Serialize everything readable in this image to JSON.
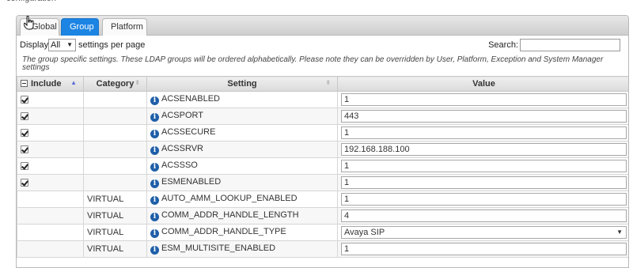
{
  "caption": "configuration",
  "tabs": [
    {
      "label": "Global",
      "active": false
    },
    {
      "label": "Group",
      "active": true
    },
    {
      "label": "Platform",
      "active": false
    }
  ],
  "controls": {
    "display_label": "Display",
    "display_value": "All",
    "per_page_label": "settings per page",
    "search_label": "Search:",
    "search_value": ""
  },
  "note": "The group specific settings. These LDAP groups will be ordered alphabetically. Please note they can be overridden by User, Platform, Exception and System Manager settings",
  "columns": {
    "include": "Include",
    "category": "Category",
    "setting": "Setting",
    "value": "Value"
  },
  "rows": [
    {
      "checked": true,
      "category": "",
      "setting": "ACSENABLED",
      "value": "1"
    },
    {
      "checked": true,
      "category": "",
      "setting": "ACSPORT",
      "value": "443"
    },
    {
      "checked": true,
      "category": "",
      "setting": "ACSSECURE",
      "value": "1"
    },
    {
      "checked": true,
      "category": "",
      "setting": "ACSSRVR",
      "value": "192.168.188.100"
    },
    {
      "checked": true,
      "category": "",
      "setting": "ACSSSO",
      "value": "1"
    },
    {
      "checked": true,
      "category": "",
      "setting": "ESMENABLED",
      "value": "1"
    },
    {
      "checked": null,
      "category": "VIRTUAL",
      "setting": "AUTO_AMM_LOOKUP_ENABLED",
      "value": "1"
    },
    {
      "checked": null,
      "category": "VIRTUAL",
      "setting": "COMM_ADDR_HANDLE_LENGTH",
      "value": "4"
    },
    {
      "checked": null,
      "category": "VIRTUAL",
      "setting": "COMM_ADDR_HANDLE_TYPE",
      "value": "Avaya SIP",
      "dropdown": true
    },
    {
      "checked": null,
      "category": "VIRTUAL",
      "setting": "ESM_MULTISITE_ENABLED",
      "value": "1"
    }
  ],
  "colors": {
    "accent": "#1c84e3",
    "info": "#1f5fa8"
  }
}
